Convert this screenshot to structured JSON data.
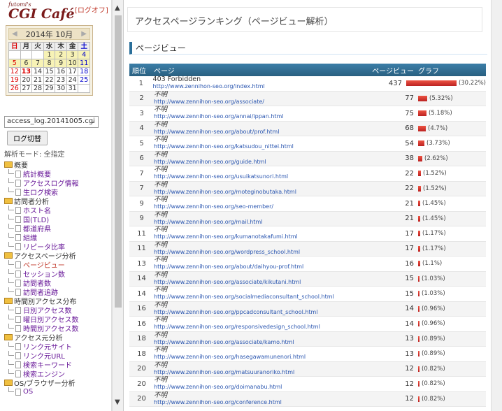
{
  "sidebar": {
    "logo_small": "futomi's",
    "logo_big": "CGI Café",
    "logout": "[ログオフ]",
    "calendar": {
      "month": "2014年 10月",
      "prev": "◀",
      "next": "▶",
      "dow": [
        "日",
        "月",
        "火",
        "水",
        "木",
        "金",
        "土"
      ],
      "weeks": [
        [
          "",
          "",
          "",
          "1",
          "2",
          "3",
          "4"
        ],
        [
          "5",
          "6",
          "7",
          "8",
          "9",
          "10",
          "11"
        ],
        [
          "12",
          "13",
          "14",
          "15",
          "16",
          "17",
          "18"
        ],
        [
          "19",
          "20",
          "21",
          "22",
          "23",
          "24",
          "25"
        ],
        [
          "26",
          "27",
          "28",
          "29",
          "30",
          "31",
          ""
        ]
      ]
    },
    "log_select": "access_log.20141005.cgi",
    "switch_button": "ログ切替",
    "mode": "解析モード: 全指定",
    "tree": [
      {
        "label": "概要",
        "children": [
          "統計概要",
          "アクセスログ情報",
          "生ログ検索"
        ]
      },
      {
        "label": "訪問者分析",
        "children": [
          "ホスト名",
          "国(TLD)",
          "都道府県",
          "組織",
          "リピータ比率"
        ]
      },
      {
        "label": "アクセスページ分析",
        "children": [
          "ページビュー",
          "セッション数",
          "訪問者数",
          "訪問者追跡"
        ]
      },
      {
        "label": "時間別アクセス分布",
        "children": [
          "日別アクセス数",
          "曜日別アクセス数",
          "時間別アクセス数"
        ]
      },
      {
        "label": "アクセス元分析",
        "children": [
          "リンク元サイト",
          "リンク元URL",
          "検索キーワード",
          "検索エンジン"
        ]
      },
      {
        "label": "OS/ブラウザー分析",
        "children": [
          "OS"
        ]
      }
    ]
  },
  "main": {
    "title": "アクセスページランキング（ページビュー解析）",
    "section": "ページビュー",
    "columns": {
      "rank": "順位",
      "page": "ページ",
      "pv": "ページビュー",
      "graph": "グラフ"
    },
    "rows": [
      {
        "rank": "1",
        "title": "403 Forbidden",
        "url": "http://www.zennihon-seo.org/index.html",
        "pv": "437",
        "pct": "(30.22%)",
        "frac": 0.3022
      },
      {
        "rank": "2",
        "title": "不明",
        "url": "http://www.zennihon-seo.org/associate/",
        "pv": "77",
        "pct": "(5.32%)",
        "frac": 0.0532
      },
      {
        "rank": "3",
        "title": "不明",
        "url": "http://www.zennihon-seo.org/annai/ippan.html",
        "pv": "75",
        "pct": "(5.18%)",
        "frac": 0.0518
      },
      {
        "rank": "4",
        "title": "不明",
        "url": "http://www.zennihon-seo.org/about/prof.html",
        "pv": "68",
        "pct": "(4.7%)",
        "frac": 0.047
      },
      {
        "rank": "5",
        "title": "不明",
        "url": "http://www.zennihon-seo.org/katsudou_nittei.html",
        "pv": "54",
        "pct": "(3.73%)",
        "frac": 0.0373
      },
      {
        "rank": "6",
        "title": "不明",
        "url": "http://www.zennihon-seo.org/guide.html",
        "pv": "38",
        "pct": "(2.62%)",
        "frac": 0.0262
      },
      {
        "rank": "7",
        "title": "不明",
        "url": "http://www.zennihon-seo.org/usuikatsunori.html",
        "pv": "22",
        "pct": "(1.52%)",
        "frac": 0.0152
      },
      {
        "rank": "7",
        "title": "不明",
        "url": "http://www.zennihon-seo.org/moteginobutaka.html",
        "pv": "22",
        "pct": "(1.52%)",
        "frac": 0.0152
      },
      {
        "rank": "9",
        "title": "不明",
        "url": "http://www.zennihon-seo.org/seo-member/",
        "pv": "21",
        "pct": "(1.45%)",
        "frac": 0.0145
      },
      {
        "rank": "9",
        "title": "不明",
        "url": "http://www.zennihon-seo.org/mail.html",
        "pv": "21",
        "pct": "(1.45%)",
        "frac": 0.0145
      },
      {
        "rank": "11",
        "title": "不明",
        "url": "http://www.zennihon-seo.org/kumanotakafumi.html",
        "pv": "17",
        "pct": "(1.17%)",
        "frac": 0.0117
      },
      {
        "rank": "11",
        "title": "不明",
        "url": "http://www.zennihon-seo.org/wordpress_school.html",
        "pv": "17",
        "pct": "(1.17%)",
        "frac": 0.0117
      },
      {
        "rank": "13",
        "title": "不明",
        "url": "http://www.zennihon-seo.org/about/daihyou-prof.html",
        "pv": "16",
        "pct": "(1.1%)",
        "frac": 0.011
      },
      {
        "rank": "14",
        "title": "不明",
        "url": "http://www.zennihon-seo.org/associate/kikutani.html",
        "pv": "15",
        "pct": "(1.03%)",
        "frac": 0.0103
      },
      {
        "rank": "14",
        "title": "不明",
        "url": "http://www.zennihon-seo.org/socialmediaconsultant_school.html",
        "pv": "15",
        "pct": "(1.03%)",
        "frac": 0.0103
      },
      {
        "rank": "16",
        "title": "不明",
        "url": "http://www.zennihon-seo.org/ppcadconsultant_school.html",
        "pv": "14",
        "pct": "(0.96%)",
        "frac": 0.0096
      },
      {
        "rank": "16",
        "title": "不明",
        "url": "http://www.zennihon-seo.org/responsivedesign_school.html",
        "pv": "14",
        "pct": "(0.96%)",
        "frac": 0.0096
      },
      {
        "rank": "18",
        "title": "不明",
        "url": "http://www.zennihon-seo.org/associate/kamo.html",
        "pv": "13",
        "pct": "(0.89%)",
        "frac": 0.0089
      },
      {
        "rank": "18",
        "title": "不明",
        "url": "http://www.zennihon-seo.org/hasegawamunenori.html",
        "pv": "13",
        "pct": "(0.89%)",
        "frac": 0.0089
      },
      {
        "rank": "20",
        "title": "不明",
        "url": "http://www.zennihon-seo.org/matsuuranoriko.html",
        "pv": "12",
        "pct": "(0.82%)",
        "frac": 0.0082
      },
      {
        "rank": "20",
        "title": "不明",
        "url": "http://www.zennihon-seo.org/doimanabu.html",
        "pv": "12",
        "pct": "(0.82%)",
        "frac": 0.0082
      },
      {
        "rank": "20",
        "title": "不明",
        "url": "http://www.zennihon-seo.org/conference.html",
        "pv": "12",
        "pct": "(0.82%)",
        "frac": 0.0082
      }
    ]
  },
  "colors": {
    "accent": "#2a6f9a",
    "bar": "#cc2222",
    "link": "#2a56b0"
  }
}
